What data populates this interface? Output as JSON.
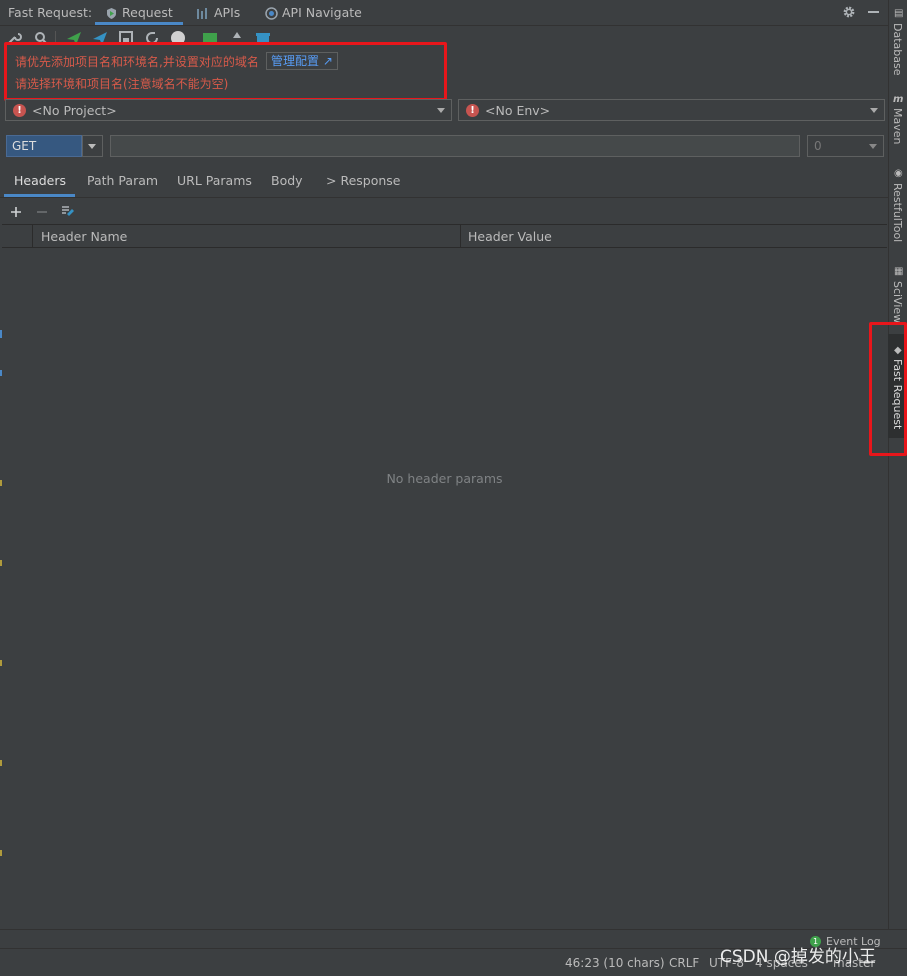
{
  "header": {
    "app_title": "Fast Request:",
    "tabs": [
      {
        "label": "Request",
        "icon": "request-icon",
        "active": true
      },
      {
        "label": "APIs",
        "icon": "apis-icon",
        "active": false
      },
      {
        "label": "API Navigate",
        "icon": "navigate-icon",
        "active": false
      }
    ]
  },
  "warning": {
    "line1": "请优先添加项目名和环境名,并设置对应的域名",
    "manage_label": "管理配置 ↗",
    "line2": "请选择环境和项目名(注意域名不能为空)",
    "color": "#d75a4a"
  },
  "selectors": {
    "project": "<No Project>",
    "env": "<No Env>"
  },
  "request": {
    "method": "GET",
    "url": "",
    "timeout": "0"
  },
  "subtabs": [
    "Headers",
    "Path Param",
    "URL Params",
    "Body",
    "> Response"
  ],
  "table": {
    "columns": [
      "Header Name",
      "Header Value"
    ],
    "empty_text": "No header params"
  },
  "right_sidebar": [
    "Database",
    "Maven",
    "RestfulTool",
    "SciView",
    "Fast Request"
  ],
  "status": {
    "event_log": "Event Log",
    "event_count": "1",
    "position": "46:23 (10 chars)",
    "line_sep": "CRLF",
    "encoding": "UTF-8",
    "indent": "4 spaces",
    "branch": "master"
  },
  "watermark": "CSDN @掉发的小王",
  "colors": {
    "accent": "#4a88c7",
    "highlight_box": "#e8161b",
    "background": "#3c3f41"
  }
}
